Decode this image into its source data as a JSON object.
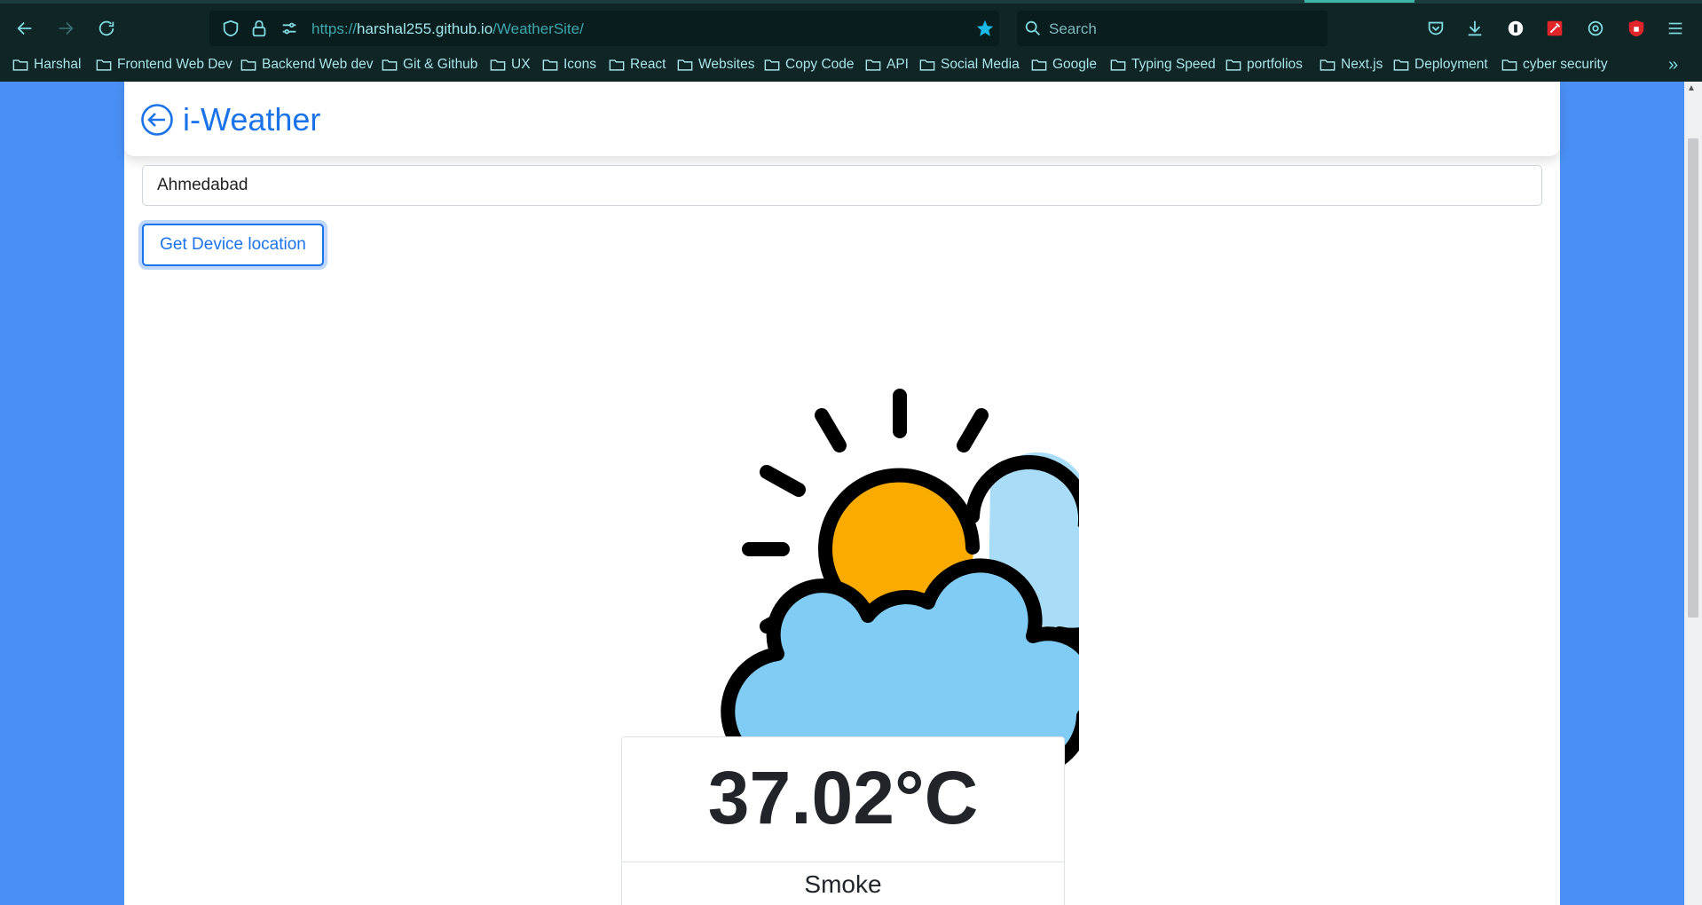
{
  "browser": {
    "url_scheme": "https://",
    "url_host": "harshal255.github.io",
    "url_path": "/WeatherSite/",
    "search_placeholder": "Search",
    "bookmarks": [
      "Harshal",
      "Frontend Web Dev",
      "Backend Web dev",
      "Git & Github",
      "UX",
      "Icons",
      "React",
      "Websites",
      "Copy Code",
      "API",
      "Social Media",
      "Google",
      "Typing Speed",
      "portfolios",
      "Next.js",
      "Deployment",
      "cyber security"
    ]
  },
  "app": {
    "title": "i-Weather",
    "city_value": "Ahmedabad",
    "location_button": "Get Device location",
    "weather_icon": "sun-behind-clouds-icon",
    "temperature": "37.02°C",
    "condition": "Smoke"
  },
  "colors": {
    "page_background": "#4a8ff5",
    "accent": "#1a73e8",
    "sun": "#f9ab00",
    "cloud_front": "#81ccf4",
    "cloud_back": "#a8dcf7"
  }
}
